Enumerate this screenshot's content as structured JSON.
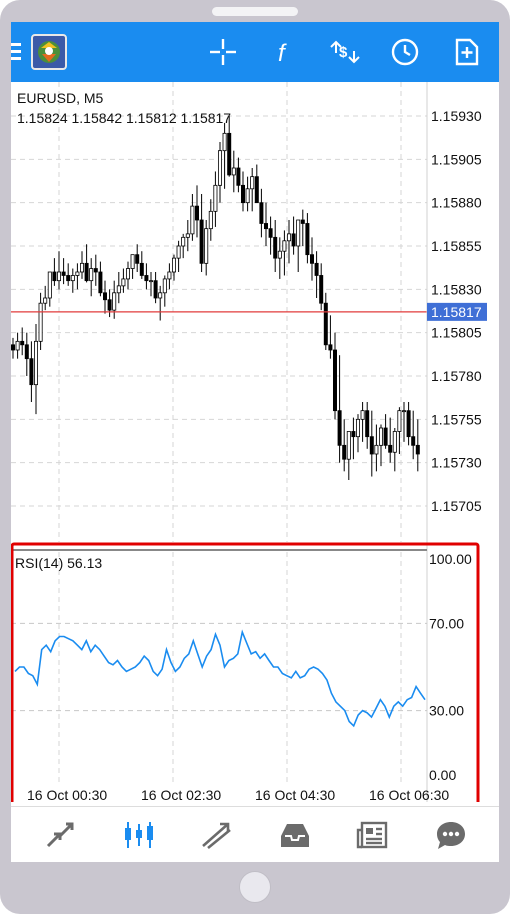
{
  "device": {
    "frame_color": "#c9c6cf"
  },
  "toolbar": {
    "menu_icon": "hamburger-icon",
    "logo_icon": "metatrader-logo-icon",
    "actions": [
      "crosshair-icon",
      "indicators-icon",
      "symbols-icon",
      "timeframe-icon",
      "new-order-icon"
    ],
    "accent": "#1a8cf0"
  },
  "main_chart": {
    "symbol_label": "EURUSD, M5",
    "ohlc_label": "1.15824 1.15842 1.15812 1.15817",
    "price_levels": [
      "1.15930",
      "1.15905",
      "1.15880",
      "1.15855",
      "1.15830",
      "1.15805",
      "1.15780",
      "1.15755",
      "1.15730",
      "1.15705"
    ],
    "current_price_label": "1.15817",
    "current_price_color": "#e23b3b",
    "current_price_badge_color": "#3f6fd6"
  },
  "rsi_panel": {
    "label": "RSI(14) 56.13",
    "levels": [
      "100.00",
      "70.00",
      "30.00",
      "0.00"
    ],
    "line_color": "#1a8cf0",
    "highlight_color": "#e00000"
  },
  "time_axis": [
    "16 Oct 00:30",
    "16 Oct 02:30",
    "16 Oct 04:30",
    "16 Oct 06:30"
  ],
  "chart_data": [
    {
      "type": "candlestick",
      "title": "EURUSD, M5",
      "ylim": [
        1.1569,
        1.1595
      ],
      "y_ticks": [
        1.1593,
        1.15905,
        1.1588,
        1.15855,
        1.1583,
        1.15805,
        1.1578,
        1.15755,
        1.1573,
        1.15705
      ],
      "current_price": 1.15817,
      "grid": true,
      "series": [
        {
          "open": [
            1.15798,
            1.15795,
            1.158,
            1.15798,
            1.1579,
            1.15775,
            1.158,
            1.15822,
            1.15825,
            1.1584,
            1.15835,
            1.1584,
            1.15838,
            1.15835,
            1.15838,
            1.1584,
            1.15845,
            1.15835,
            1.15842,
            1.1584,
            1.15828,
            1.15824,
            1.15818,
            1.15828,
            1.15832,
            1.15836,
            1.15842,
            1.1585,
            1.15845,
            1.15838,
            1.15835,
            1.15835,
            1.15825,
            1.15828,
            1.15836,
            1.1584,
            1.15848,
            1.15855,
            1.1586,
            1.15862,
            1.15878,
            1.1587,
            1.15845,
            1.15865,
            1.15875,
            1.1589,
            1.1591,
            1.1592,
            1.15896,
            1.159,
            1.1589,
            1.1588,
            1.15888,
            1.15895,
            1.1588,
            1.15868,
            1.15865,
            1.1586,
            1.15848,
            1.15852,
            1.15858,
            1.15862,
            1.15855,
            1.1587,
            1.15868,
            1.1585,
            1.15845,
            1.15838,
            1.15822,
            1.15798,
            1.15795,
            1.1576,
            1.1574,
            1.15732,
            1.15748,
            1.15745,
            1.15755,
            1.1576,
            1.15745,
            1.15735,
            1.1574,
            1.1575,
            1.1574,
            1.15736,
            1.15748,
            1.1576,
            1.1576,
            1.15745,
            1.1574
          ],
          "high": [
            1.15802,
            1.15805,
            1.15808,
            1.15805,
            1.158,
            1.1581,
            1.15828,
            1.15832,
            1.15838,
            1.15848,
            1.15852,
            1.15848,
            1.15845,
            1.15842,
            1.15845,
            1.15852,
            1.15856,
            1.15848,
            1.1585,
            1.15846,
            1.15835,
            1.1583,
            1.15835,
            1.1584,
            1.15842,
            1.15846,
            1.1585,
            1.15856,
            1.15852,
            1.15845,
            1.1584,
            1.1584,
            1.15832,
            1.15838,
            1.15845,
            1.1585,
            1.15858,
            1.15862,
            1.1587,
            1.15885,
            1.1589,
            1.15885,
            1.1587,
            1.15882,
            1.15898,
            1.15915,
            1.15926,
            1.1593,
            1.1591,
            1.15906,
            1.15898,
            1.15895,
            1.159,
            1.15902,
            1.15888,
            1.1588,
            1.15872,
            1.1587,
            1.1586,
            1.15864,
            1.1587,
            1.15872,
            1.15868,
            1.15876,
            1.15874,
            1.1586,
            1.15852,
            1.15845,
            1.15828,
            1.15815,
            1.15805,
            1.15792,
            1.15755,
            1.15745,
            1.15756,
            1.15758,
            1.15765,
            1.15765,
            1.1576,
            1.15752,
            1.15752,
            1.15758,
            1.15756,
            1.1575,
            1.15762,
            1.15765,
            1.15765,
            1.1576,
            1.15755
          ],
          "low": [
            1.1579,
            1.1579,
            1.15792,
            1.1578,
            1.15765,
            1.15758,
            1.15795,
            1.15818,
            1.1582,
            1.15832,
            1.1583,
            1.15833,
            1.15832,
            1.15828,
            1.1583,
            1.15836,
            1.15834,
            1.15826,
            1.15832,
            1.15826,
            1.15816,
            1.15814,
            1.15813,
            1.15822,
            1.15828,
            1.1583,
            1.15836,
            1.1584,
            1.15836,
            1.1583,
            1.15826,
            1.15822,
            1.15812,
            1.1582,
            1.1583,
            1.15835,
            1.1584,
            1.15848,
            1.15852,
            1.15858,
            1.1586,
            1.1584,
            1.15838,
            1.15858,
            1.15866,
            1.1588,
            1.15888,
            1.15895,
            1.15886,
            1.15886,
            1.15875,
            1.15875,
            1.15875,
            1.1588,
            1.1586,
            1.15855,
            1.1585,
            1.1584,
            1.15836,
            1.15838,
            1.15845,
            1.1585,
            1.1584,
            1.15855,
            1.15845,
            1.15835,
            1.15825,
            1.15818,
            1.15795,
            1.1579,
            1.15755,
            1.1573,
            1.15725,
            1.1572,
            1.15732,
            1.15736,
            1.15742,
            1.15738,
            1.15722,
            1.15725,
            1.15728,
            1.15738,
            1.1573,
            1.15725,
            1.15735,
            1.15742,
            1.1574,
            1.15732,
            1.15725
          ],
          "close": [
            1.15795,
            1.158,
            1.15798,
            1.1579,
            1.15775,
            1.158,
            1.15822,
            1.15825,
            1.1584,
            1.15835,
            1.1584,
            1.15838,
            1.15835,
            1.15838,
            1.1584,
            1.15845,
            1.15835,
            1.15842,
            1.1584,
            1.15828,
            1.15824,
            1.15818,
            1.15828,
            1.15832,
            1.15836,
            1.15842,
            1.1585,
            1.15845,
            1.15838,
            1.15835,
            1.15835,
            1.15825,
            1.15828,
            1.15836,
            1.1584,
            1.15848,
            1.15855,
            1.1586,
            1.15862,
            1.15878,
            1.1587,
            1.15845,
            1.15865,
            1.15875,
            1.1589,
            1.1591,
            1.1592,
            1.15896,
            1.159,
            1.1589,
            1.1588,
            1.15888,
            1.15895,
            1.1588,
            1.15868,
            1.15865,
            1.1586,
            1.15848,
            1.15852,
            1.15858,
            1.15862,
            1.15855,
            1.1587,
            1.15868,
            1.1585,
            1.15845,
            1.15838,
            1.15822,
            1.15798,
            1.15795,
            1.1576,
            1.1574,
            1.15732,
            1.15748,
            1.15745,
            1.15755,
            1.1576,
            1.15745,
            1.15735,
            1.1574,
            1.1575,
            1.1574,
            1.15736,
            1.15748,
            1.1576,
            1.1576,
            1.15745,
            1.1574,
            1.15735
          ]
        }
      ]
    },
    {
      "type": "line",
      "title": "RSI(14) 56.13",
      "ylim": [
        0,
        100
      ],
      "y_ticks": [
        100,
        70,
        30,
        0
      ],
      "x": [
        "16 Oct 00:30",
        "16 Oct 02:30",
        "16 Oct 04:30",
        "16 Oct 06:30"
      ],
      "grid": true,
      "series": [
        {
          "values": [
            48,
            50,
            50,
            47,
            46,
            42,
            58,
            60,
            57,
            62,
            64,
            64,
            63,
            62,
            60,
            58,
            62,
            57,
            60,
            58,
            55,
            52,
            51,
            53,
            50,
            48,
            49,
            50,
            52,
            55,
            53,
            48,
            46,
            49,
            58,
            52,
            48,
            50,
            54,
            56,
            62,
            56,
            50,
            55,
            58,
            65,
            60,
            50,
            53,
            54,
            56,
            66,
            61,
            56,
            57,
            54,
            56,
            53,
            50,
            50,
            47,
            46,
            45,
            48,
            45,
            46,
            49,
            50,
            49,
            47,
            44,
            38,
            34,
            32,
            30,
            25,
            23,
            28,
            30,
            29,
            27,
            31,
            35,
            32,
            27,
            32,
            34,
            32,
            35,
            36,
            41,
            38,
            35
          ],
          "last": 56.13
        }
      ]
    }
  ]
}
